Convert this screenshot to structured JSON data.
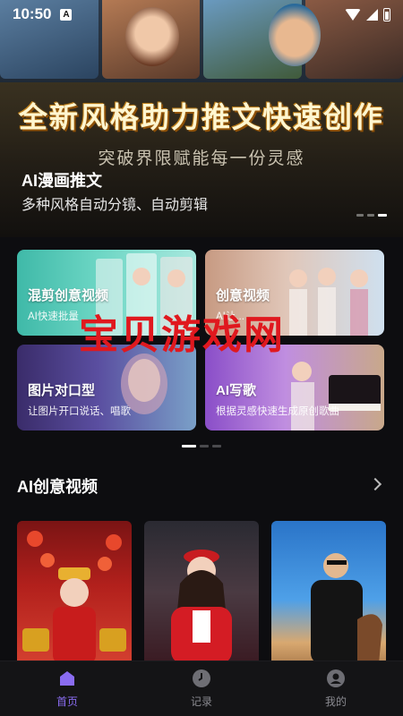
{
  "status_bar": {
    "time": "10:50",
    "notification_letter": "A"
  },
  "banner": {
    "headline": "全新风格助力推文快速创作",
    "subheadline": "突破界限赋能每一份灵感",
    "title": "AI漫画推文",
    "description": "多种风格自动分镜、自动剪辑",
    "page_count": 3,
    "active_page": 3
  },
  "features": [
    {
      "title": "混剪创意视频",
      "desc": "AI快速批量"
    },
    {
      "title": "创意视频",
      "desc": "AI让..."
    },
    {
      "title": "图片对口型",
      "desc": "让图片开口说话、唱歌"
    },
    {
      "title": "AI写歌",
      "desc": "根据灵感快速生成原创歌曲"
    }
  ],
  "features_page_count": 3,
  "features_active_page": 1,
  "watermark": "宝贝游戏网",
  "section": {
    "title": "AI创意视频"
  },
  "bottom_nav": [
    {
      "label": "首页",
      "icon": "home-icon",
      "active": true
    },
    {
      "label": "记录",
      "icon": "clock-icon",
      "active": false
    },
    {
      "label": "我的",
      "icon": "profile-icon",
      "active": false
    }
  ],
  "colors": {
    "accent": "#8a6cf0",
    "watermark": "#e0181e",
    "background": "#0d0d10"
  }
}
